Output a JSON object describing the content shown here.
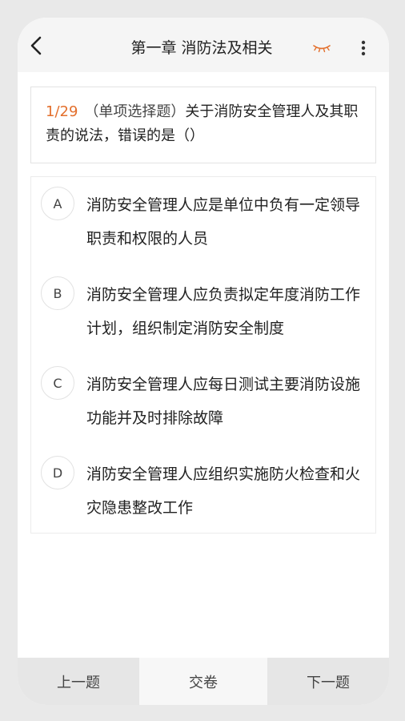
{
  "header": {
    "title": "第一章 消防法及相关",
    "back_icon": "chevron-left-icon",
    "eye_icon": "eye-closed-icon",
    "more_icon": "more-vertical-icon",
    "accent_color": "#e36f2c"
  },
  "question": {
    "number": "1/29",
    "type": "（单项选择题）",
    "text": "关于消防安全管理人及其职责的说法，错误的是（）"
  },
  "options": [
    {
      "letter": "A",
      "text": "消防安全管理人应是单位中负有一定领导职责和权限的人员"
    },
    {
      "letter": "B",
      "text": "消防安全管理人应负责拟定年度消防工作计划，组织制定消防安全制度"
    },
    {
      "letter": "C",
      "text": "消防安全管理人应每日测试主要消防设施功能并及时排除故障"
    },
    {
      "letter": "D",
      "text": "消防安全管理人应组织实施防火检查和火灾隐患整改工作"
    }
  ],
  "footer": {
    "prev_label": "上一题",
    "submit_label": "交卷",
    "next_label": "下一题"
  }
}
